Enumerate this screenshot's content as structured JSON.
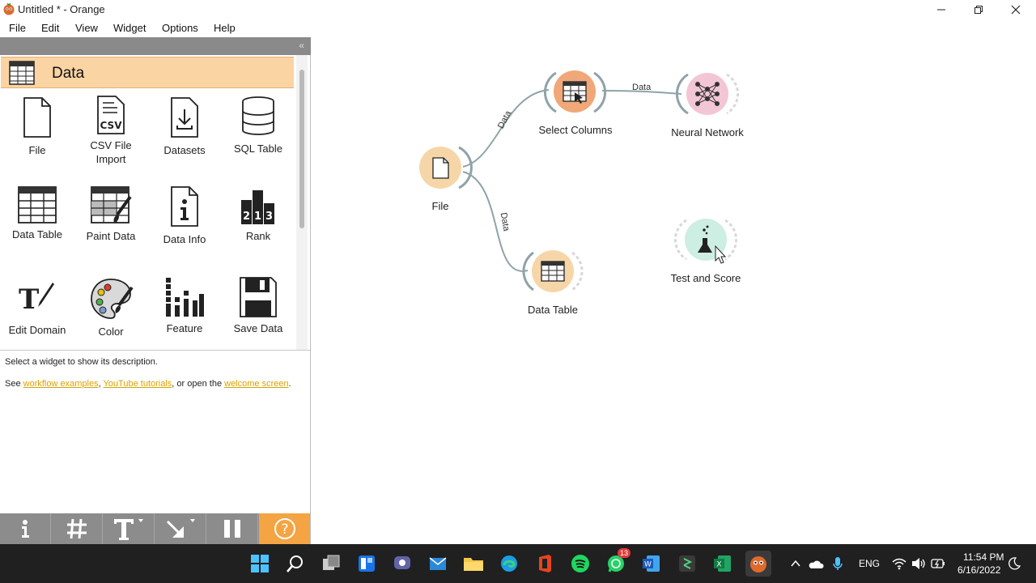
{
  "window": {
    "title": "Untitled * - Orange",
    "minimize": "—",
    "maximize": "❐",
    "close": "✕"
  },
  "menu": [
    "File",
    "Edit",
    "View",
    "Widget",
    "Options",
    "Help"
  ],
  "toolbox": {
    "dock_button": "«",
    "category": "Data",
    "widgets": [
      {
        "label": "File",
        "icon": "file-icon"
      },
      {
        "label": "CSV File Import",
        "icon": "csv-icon"
      },
      {
        "label": "Datasets",
        "icon": "datasets-icon"
      },
      {
        "label": "SQL Table",
        "icon": "database-icon"
      },
      {
        "label": "Data Table",
        "icon": "table-icon"
      },
      {
        "label": "Paint Data",
        "icon": "paint-data-icon"
      },
      {
        "label": "Data Info",
        "icon": "info-icon"
      },
      {
        "label": "Rank",
        "icon": "rank-icon"
      },
      {
        "label": "Edit Domain",
        "icon": "edit-domain-icon"
      },
      {
        "label": "Color",
        "icon": "palette-icon"
      },
      {
        "label": "Feature",
        "icon": "feature-icon"
      },
      {
        "label": "Save Data",
        "icon": "save-icon"
      }
    ]
  },
  "description": {
    "line1": "Select a widget to show its description.",
    "see": "See ",
    "link1": "workflow examples",
    "sep1": ", ",
    "link2": "YouTube tutorials",
    "sep2": ", or open the ",
    "link3": "welcome screen",
    "end": "."
  },
  "bottom_toolbar": [
    {
      "name": "info-button",
      "icon": "info-icon",
      "glyph": "i"
    },
    {
      "name": "grid-button",
      "icon": "grid-icon",
      "glyph": "#"
    },
    {
      "name": "text-annotation-button",
      "icon": "text-icon",
      "glyph": "T"
    },
    {
      "name": "arrow-annotation-button",
      "icon": "arrow-icon",
      "glyph": "↘"
    },
    {
      "name": "pause-button",
      "icon": "pause-icon",
      "glyph": "❚❚"
    },
    {
      "name": "help-button",
      "icon": "question-icon",
      "glyph": "?"
    }
  ],
  "canvas": {
    "nodes": {
      "file": "File",
      "select_columns": "Select Columns",
      "neural_network": "Neural Network",
      "data_table": "Data Table",
      "test_and_score": "Test and Score"
    },
    "links": {
      "file_to_select": "Data",
      "select_to_nn": "Data",
      "file_to_table": "Data"
    }
  },
  "taskbar": {
    "whatsapp_badge": "13",
    "language": "ENG",
    "time": "11:54 PM",
    "date": "6/16/2022"
  },
  "colors": {
    "category_bg": "#fbd4a3",
    "help_button": "#f4a442",
    "link_color": "#d9a200",
    "file_node": "#f6d6a8",
    "select_node": "#f0a878",
    "nn_node": "#f3c6d6",
    "table_node": "#f6d6a8",
    "score_node": "#cdeee2"
  }
}
